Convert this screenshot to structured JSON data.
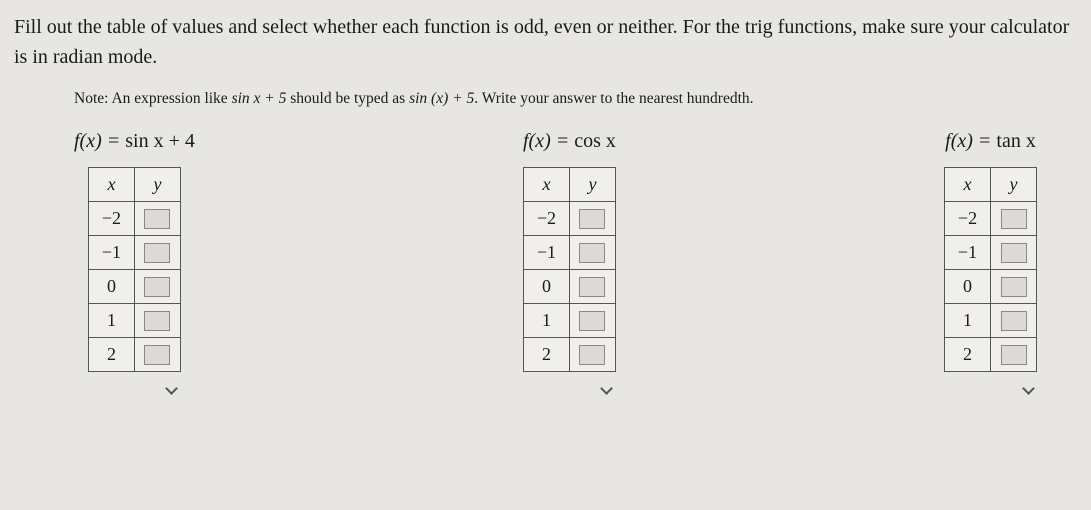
{
  "instructions": "Fill out the table of values and select whether each function is odd, even or neither. For the trig functions, make sure your calculator is in radian mode.",
  "note_prefix": "Note: An expression like ",
  "note_expr1": "sin x + 5",
  "note_mid": " should be typed as ",
  "note_expr2": "sin (x) + 5",
  "note_suffix": ". Write your answer to the nearest hundredth.",
  "functions": [
    {
      "label_prefix": "f(x) = ",
      "label_fn": "sin x + 4",
      "header_x": "x",
      "header_y": "y",
      "rows": [
        "−2",
        "−1",
        "0",
        "1",
        "2"
      ]
    },
    {
      "label_prefix": "f(x) = ",
      "label_fn": "cos x",
      "header_x": "x",
      "header_y": "y",
      "rows": [
        "−2",
        "−1",
        "0",
        "1",
        "2"
      ]
    },
    {
      "label_prefix": "f(x) = ",
      "label_fn": "tan x",
      "header_x": "x",
      "header_y": "y",
      "rows": [
        "−2",
        "−1",
        "0",
        "1",
        "2"
      ]
    }
  ]
}
